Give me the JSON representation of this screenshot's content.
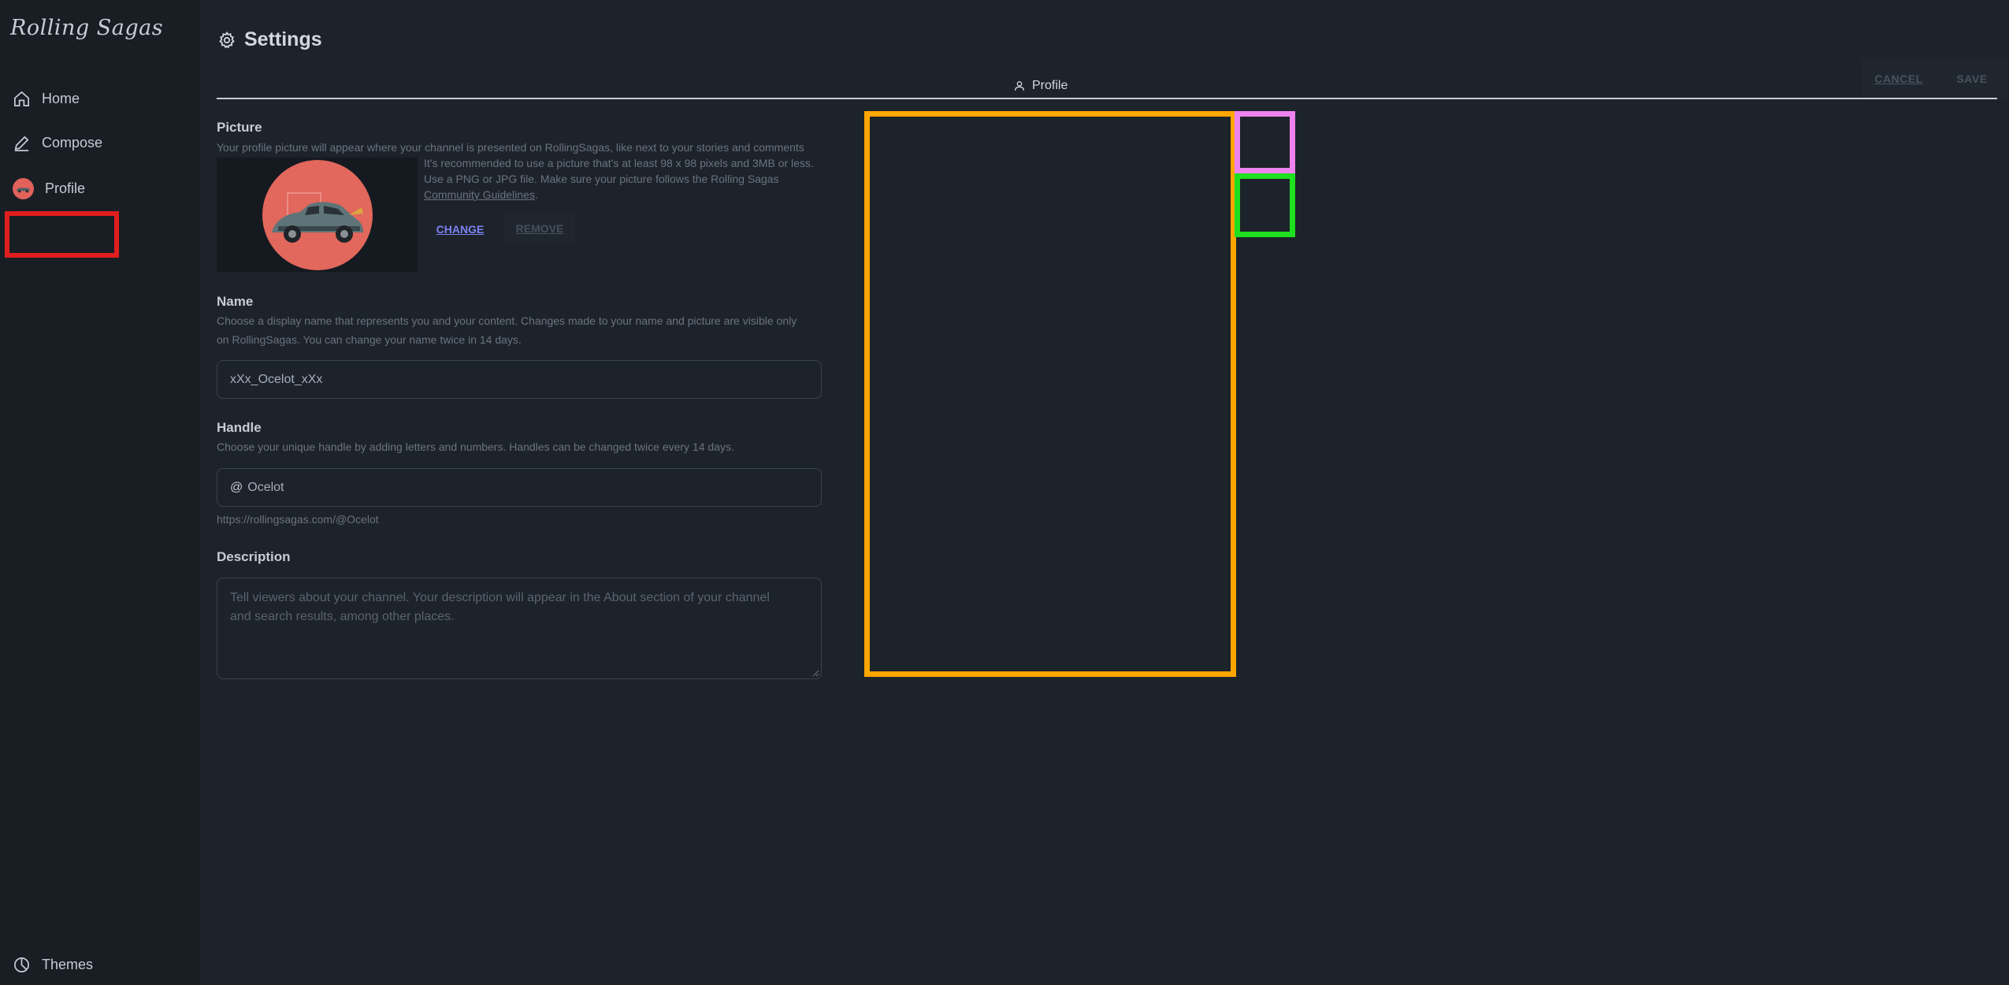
{
  "app": {
    "brand": "Rolling Sagas"
  },
  "sidebar": {
    "items": [
      {
        "label": "Home",
        "icon": "home-icon"
      },
      {
        "label": "Compose",
        "icon": "pencil-icon"
      },
      {
        "label": "Profile",
        "icon": "avatar"
      }
    ],
    "footer": {
      "label": "Themes",
      "icon": "palette-icon"
    }
  },
  "header": {
    "title": "Settings",
    "cancel_label": "CANCEL",
    "save_label": "SAVE"
  },
  "tabs": [
    {
      "label": "Profile",
      "icon": "user-icon"
    }
  ],
  "picture": {
    "label": "Picture",
    "description": "Your profile picture will appear where your channel is presented on RollingSagas, like next to your stories and comments",
    "note_line1": "It's recommended to use a picture that's at least 98 x 98 pixels and 3MB or less.",
    "note_line2": "Use a PNG or JPG file. Make sure your picture follows the Rolling Sagas",
    "note_link": "Community Guidelines",
    "note_end": ".",
    "change_label": "CHANGE",
    "remove_label": "REMOVE"
  },
  "name": {
    "label": "Name",
    "description_line1": "Choose a display name that represents you and your content. Changes made to your name and picture are visible only",
    "description_line2": "on RollingSagas. You can change your name twice in 14 days.",
    "value": "xXx_Ocelot_xXx"
  },
  "handle": {
    "label": "Handle",
    "description": "Choose your unique handle by adding letters and numbers. Handles can be changed twice every 14 days.",
    "prefix": "@",
    "value": "Ocelot",
    "url": "https://rollingsagas.com/@Ocelot"
  },
  "description_field": {
    "label": "Description",
    "placeholder_line1": "Tell viewers about your channel.  Your description will appear in the About section of  your channel",
    "placeholder_line2": "and search results, among other places."
  },
  "colors": {
    "background": "#1d232a",
    "sidebar": "#191e24",
    "link": "#7b83f2",
    "avatar": "#e2675c",
    "highlight_red": "#e01e1e",
    "highlight_orange": "#ffa600",
    "highlight_pink": "#ee82ee",
    "highlight_green": "#1ee01e"
  }
}
